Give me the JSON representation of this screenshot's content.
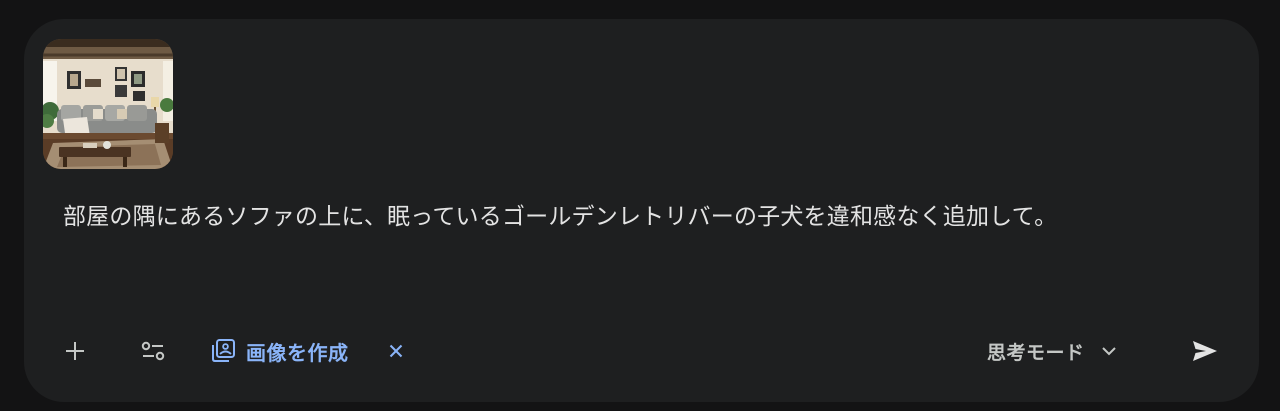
{
  "attachment": {
    "alt": "living room with sofa"
  },
  "prompt": {
    "text": "部屋の隅にあるソファの上に、眠っているゴールデンレトリバーの子犬を違和感なく追加して。"
  },
  "toolbar": {
    "add_icon": "plus-icon",
    "tools_icon": "tune-icon",
    "image_chip_icon": "image-stack-icon",
    "image_chip_label": "画像を作成",
    "image_chip_close_icon": "close-icon",
    "mode_label": "思考モード",
    "mode_chevron_icon": "chevron-down-icon",
    "send_icon": "send-icon"
  },
  "colors": {
    "page_bg": "#131314",
    "composer_bg": "#1e1f20",
    "text": "#e3e3e3",
    "accent": "#8ab4f8",
    "muted": "#c4c7c5"
  }
}
